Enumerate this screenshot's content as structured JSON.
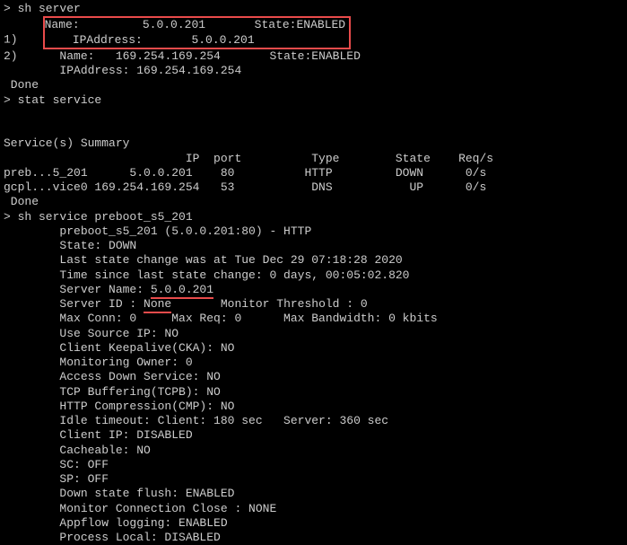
{
  "cmd1": "> sh server",
  "srv1_idx": "1)",
  "srv1_name_label": "Name:",
  "srv1_name": "5.0.0.201",
  "srv1_state_label": "State:",
  "srv1_state": "ENABLED",
  "srv1_ip_label": "IPAddress:",
  "srv1_ip": "5.0.0.201",
  "srv2_idx": "2)",
  "srv2_line1": "Name:   169.254.169.254       State:ENABLED",
  "srv2_line2": "IPAddress: 169.254.169.254",
  "done1": " Done",
  "cmd2": "> stat service",
  "blank": " ",
  "svc_summary": "Service(s) Summary",
  "svc_hdr": "                          IP  port          Type        State    Req/s",
  "svc_row1": "preb...5_201      5.0.0.201    80          HTTP         DOWN      0/s",
  "svc_row2": "gcpl...vice0 169.254.169.254   53           DNS           UP      0/s",
  "done2": " Done",
  "cmd3": "> sh service preboot_s5_201",
  "d01": "        preboot_s5_201 (5.0.0.201:80) - HTTP",
  "d02": "        State: DOWN",
  "d03": "        Last state change was at Tue Dec 29 07:18:28 2020",
  "d04": "        Time since last state change: 0 days, 00:05:02.820",
  "d05a": "        Server Name: ",
  "d05b": "5.0.0.201",
  "d06a": "        Server ID : ",
  "d06b": "None",
  "d06c": "       Monitor Threshold : 0",
  "d07": "        Max Conn: 0     Max Req: 0      Max Bandwidth: 0 kbits",
  "d08": "        Use Source IP: NO",
  "d09": "        Client Keepalive(CKA): NO",
  "d10": "        Monitoring Owner: 0",
  "d11": "        Access Down Service: NO",
  "d12": "        TCP Buffering(TCPB): NO",
  "d13": "        HTTP Compression(CMP): NO",
  "d14": "        Idle timeout: Client: 180 sec   Server: 360 sec",
  "d15": "        Client IP: DISABLED",
  "d16": "        Cacheable: NO",
  "d17": "        SC: OFF",
  "d18": "        SP: OFF",
  "d19": "        Down state flush: ENABLED",
  "d20": "        Monitor Connection Close : NONE",
  "d21": "        Appflow logging: ENABLED",
  "d22": "        Process Local: DISABLED"
}
